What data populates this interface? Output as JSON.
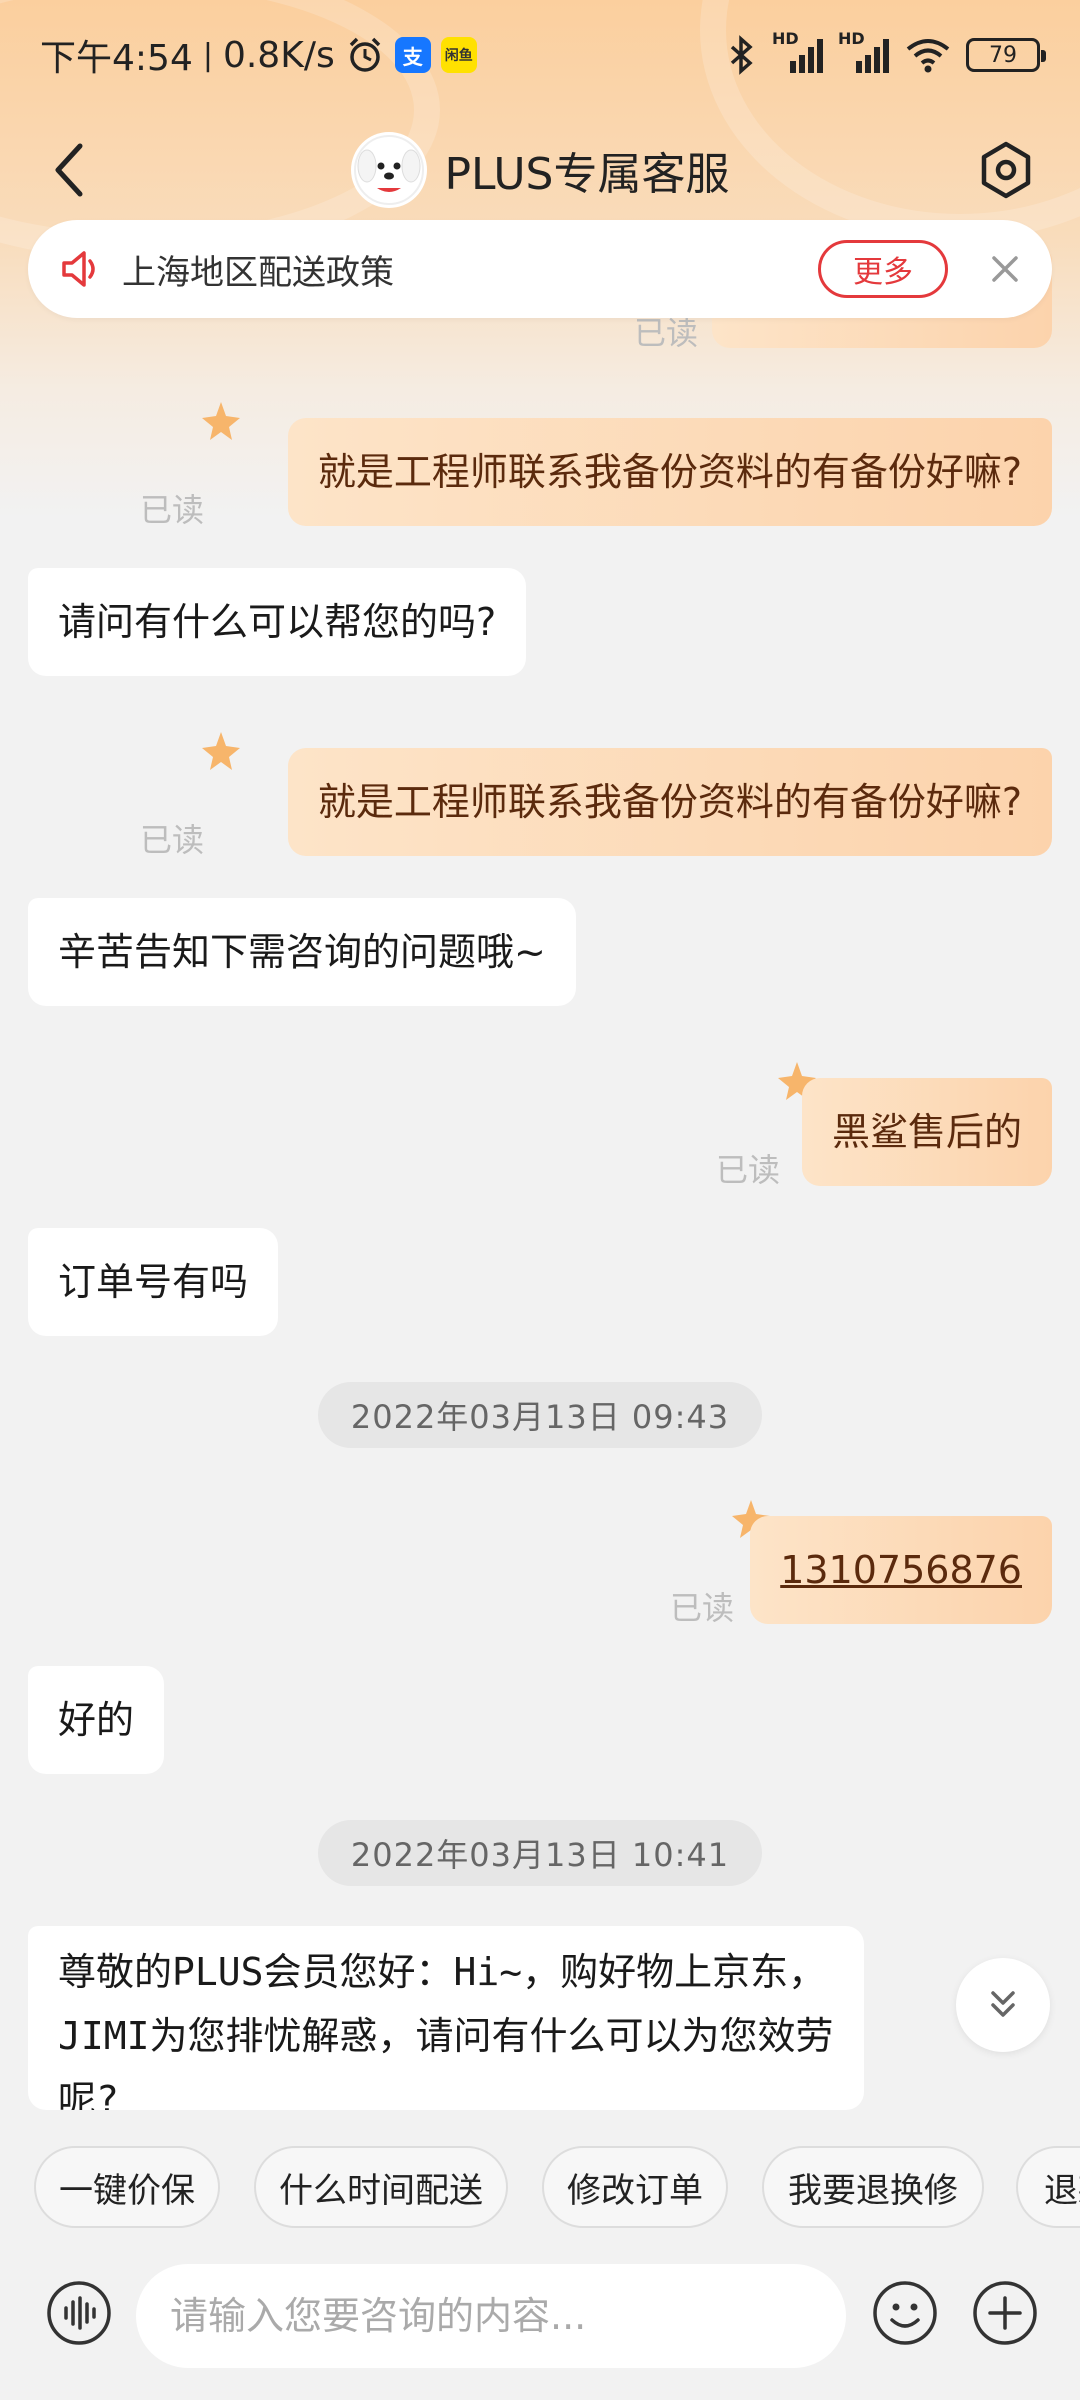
{
  "status_bar": {
    "time": "下午4:54",
    "speed": "0.8K/s",
    "app1_icon": "支",
    "app2_icon": "闲鱼",
    "net1": "HD",
    "net2": "HD",
    "battery": "79"
  },
  "header": {
    "title": "PLUS专属客服",
    "back_icon": "chevron-left-icon",
    "settings_icon": "hexagon-settings-icon"
  },
  "notice": {
    "text": "上海地区配送政策",
    "more_label": "更多",
    "speaker_icon": "speaker-icon",
    "close_icon": "close-icon"
  },
  "messages": [
    {
      "side": "out",
      "text": "",
      "read": "已读"
    },
    {
      "side": "out",
      "text": "就是工程师联系我备份资料的有备份好嘛?",
      "read": "已读"
    },
    {
      "side": "in",
      "text": "请问有什么可以帮您的吗?"
    },
    {
      "side": "out",
      "text": "就是工程师联系我备份资料的有备份好嘛?",
      "read": "已读"
    },
    {
      "side": "in",
      "text": "辛苦告知下需咨询的问题哦~"
    },
    {
      "side": "out",
      "text": "黑鲨售后的",
      "read": "已读"
    },
    {
      "side": "in",
      "text": "订单号有吗"
    },
    {
      "type": "timestamp",
      "text": "2022年03月13日 09:43"
    },
    {
      "side": "out",
      "text": "1310756876",
      "read": "已读"
    },
    {
      "side": "in",
      "text": "好的"
    },
    {
      "type": "timestamp",
      "text": "2022年03月13日 10:41"
    },
    {
      "side": "in",
      "text": "尊敬的PLUS会员您好：Hi~，购好物上京东，JIMI为您排忧解惑，请问有什么可以为您效劳呢?"
    }
  ],
  "quick_replies": [
    "一键价保",
    "什么时间配送",
    "修改订单",
    "我要退换修",
    "退款"
  ],
  "input": {
    "placeholder": "请输入您要咨询的内容..."
  },
  "colors": {
    "accent": "#e4393c",
    "out_bubble": "#fcd3ac",
    "out_text": "#5b2a0d",
    "background": "#f2f2f2"
  }
}
